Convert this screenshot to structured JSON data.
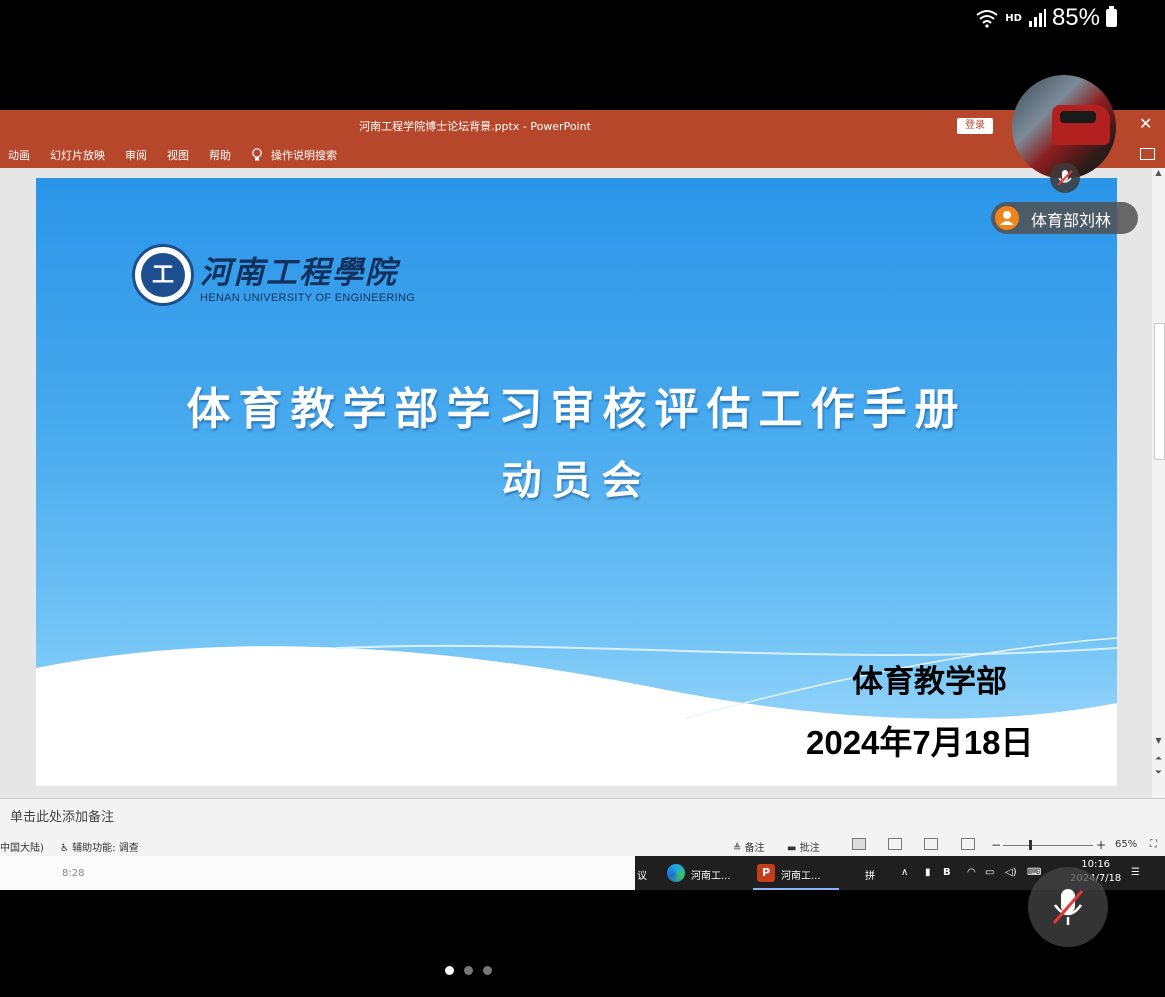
{
  "phone_status": {
    "network": "HD",
    "battery": "85%"
  },
  "ppt": {
    "doc_title": "河南工程学院博士论坛背景.pptx  -  PowerPoint",
    "login": "登录",
    "close": "✕",
    "tabs": [
      "动画",
      "幻灯片放映",
      "审阅",
      "视图",
      "帮助"
    ],
    "tell_me": "操作说明搜索"
  },
  "slide": {
    "logo_name": "河南工程學院",
    "logo_en": "HENAN UNIVERSITY OF ENGINEERING",
    "title": "体育教学部学习审核评估工作手册",
    "subtitle": "动员会",
    "dept": "体育教学部",
    "date": "2024年7月18日"
  },
  "notes": {
    "placeholder": "单击此处添加备注"
  },
  "status_bar": {
    "language": "中国大陆)",
    "accessibility": "辅助功能: 调查",
    "notes_btn": "备注",
    "comments_btn": "批注",
    "zoom": "65%",
    "zoom_level": 0.65
  },
  "taskbar": {
    "left_time": "8:28",
    "meeting_fragment": "议",
    "edge_label": "河南工...",
    "ppt_label": "河南工...",
    "ime": "拼",
    "clock_time": "10:16",
    "clock_date": "2024/7/18"
  },
  "video": {
    "participant": "体育部刘林"
  },
  "pager": {
    "pages": 3,
    "active": 0
  }
}
